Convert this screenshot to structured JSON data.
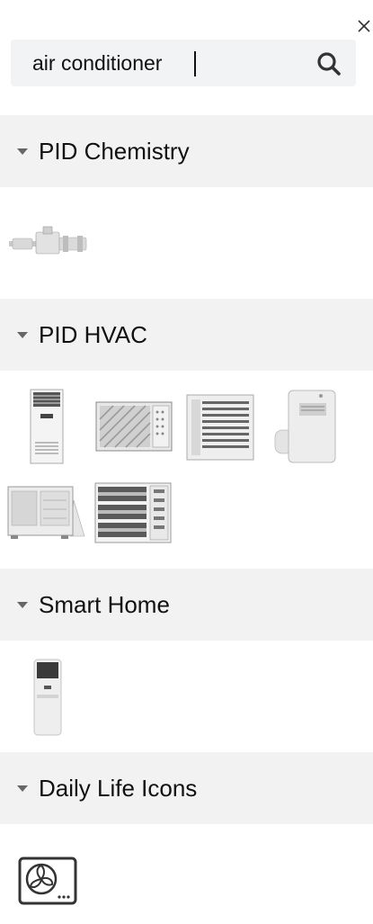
{
  "search": {
    "value": "air conditioner",
    "placeholder": "",
    "search_icon": "search-icon"
  },
  "close_icon": "close-icon",
  "categories": [
    {
      "label": "PID Chemistry",
      "items": [
        "pid-valve-fitting"
      ]
    },
    {
      "label": "PID HVAC",
      "items": [
        "floor-standing-ac-unit",
        "window-ac-unit",
        "louvered-ac-unit",
        "portable-ac-unit",
        "outdoor-condenser-unit",
        "ventilation-grille-unit"
      ]
    },
    {
      "label": "Smart Home",
      "items": [
        "smart-floor-ac-unit"
      ]
    },
    {
      "label": "Daily Life Icons",
      "items": [
        "air-conditioner-fan-icon"
      ]
    }
  ],
  "colors": {
    "category_bg": "#f2f2f2",
    "search_bg": "#f2f3f5"
  }
}
